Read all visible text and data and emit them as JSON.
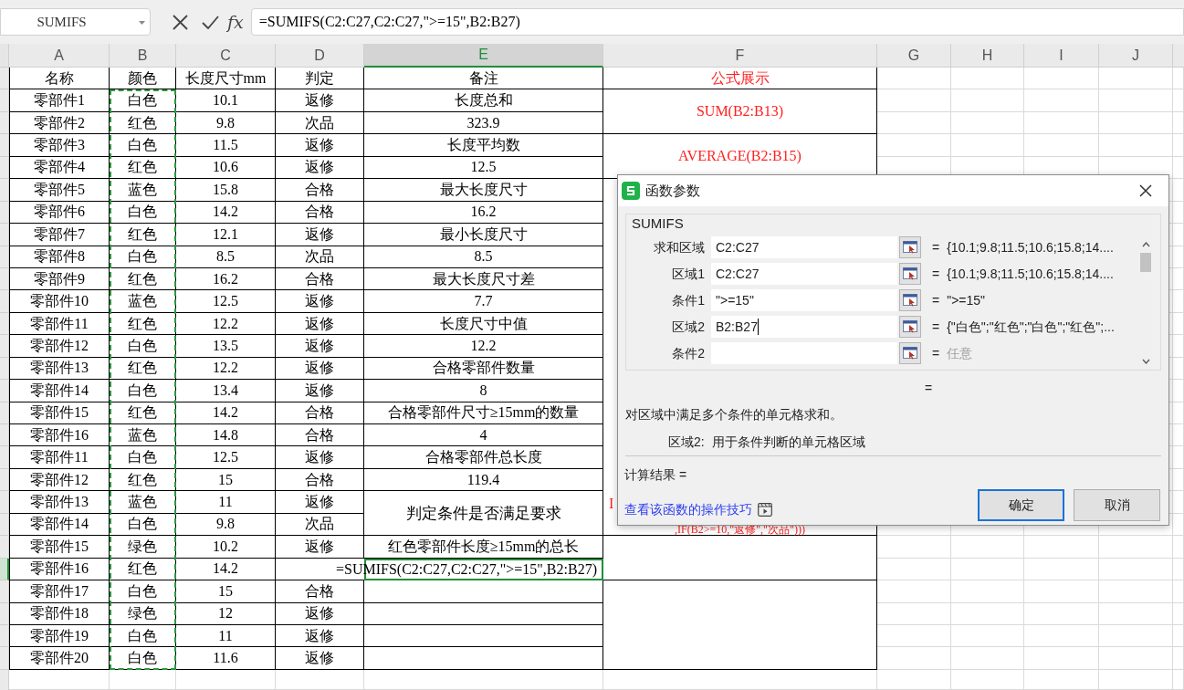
{
  "name_box": "SUMIFS",
  "fx_label": "fx",
  "formula_bar": {
    "value": "=SUMIFS(C2:C27,C2:C27,\">=15\",B2:B27)"
  },
  "columns": [
    {
      "label": "A",
      "selected": false
    },
    {
      "label": "B",
      "selected": false
    },
    {
      "label": "C",
      "selected": false
    },
    {
      "label": "D",
      "selected": false
    },
    {
      "label": "E",
      "selected": true
    },
    {
      "label": "F",
      "selected": false
    },
    {
      "label": "G",
      "selected": false
    },
    {
      "label": "H",
      "selected": false
    },
    {
      "label": "I",
      "selected": false
    },
    {
      "label": "J",
      "selected": false
    }
  ],
  "table": {
    "headers": [
      "名称",
      "颜色",
      "长度尺寸mm",
      "判定",
      "备注"
    ],
    "rows": [
      {
        "name": "零部件1",
        "shade": "白色",
        "length": "10.1",
        "verdict": "返修",
        "selected": false
      },
      {
        "name": "零部件2",
        "shade": "红色",
        "length": "9.8",
        "verdict": "次品",
        "selected": false
      },
      {
        "name": "零部件3",
        "shade": "白色",
        "length": "11.5",
        "verdict": "返修",
        "selected": false
      },
      {
        "name": "零部件4",
        "shade": "红色",
        "length": "10.6",
        "verdict": "返修",
        "selected": false
      },
      {
        "name": "零部件5",
        "shade": "蓝色",
        "length": "15.8",
        "verdict": "合格",
        "selected": false
      },
      {
        "name": "零部件6",
        "shade": "白色",
        "length": "14.2",
        "verdict": "合格",
        "selected": false
      },
      {
        "name": "零部件7",
        "shade": "红色",
        "length": "12.1",
        "verdict": "返修",
        "selected": false
      },
      {
        "name": "零部件8",
        "shade": "白色",
        "length": "8.5",
        "verdict": "次品",
        "selected": false
      },
      {
        "name": "零部件9",
        "shade": "红色",
        "length": "16.2",
        "verdict": "合格",
        "selected": false
      },
      {
        "name": "零部件10",
        "shade": "蓝色",
        "length": "12.5",
        "verdict": "返修",
        "selected": false
      },
      {
        "name": "零部件11",
        "shade": "红色",
        "length": "12.2",
        "verdict": "返修",
        "selected": false
      },
      {
        "name": "零部件12",
        "shade": "白色",
        "length": "13.5",
        "verdict": "返修",
        "selected": false
      },
      {
        "name": "零部件13",
        "shade": "红色",
        "length": "12.2",
        "verdict": "返修",
        "selected": false
      },
      {
        "name": "零部件14",
        "shade": "白色",
        "length": "13.4",
        "verdict": "返修",
        "selected": false
      },
      {
        "name": "零部件15",
        "shade": "红色",
        "length": "14.2",
        "verdict": "合格",
        "selected": false
      },
      {
        "name": "零部件16",
        "shade": "蓝色",
        "length": "14.8",
        "verdict": "合格",
        "selected": false
      },
      {
        "name": "零部件11",
        "shade": "白色",
        "length": "12.5",
        "verdict": "返修",
        "selected": false
      },
      {
        "name": "零部件12",
        "shade": "红色",
        "length": "15",
        "verdict": "合格",
        "selected": false
      },
      {
        "name": "零部件13",
        "shade": "蓝色",
        "length": "11",
        "verdict": "返修",
        "selected": false
      },
      {
        "name": "零部件14",
        "shade": "白色",
        "length": "9.8",
        "verdict": "次品",
        "selected": false
      },
      {
        "name": "零部件15",
        "shade": "绿色",
        "length": "10.2",
        "verdict": "返修",
        "selected": false
      },
      {
        "name": "零部件16",
        "shade": "红色",
        "length": "14.2",
        "selected": true
      },
      {
        "name": "零部件17",
        "shade": "白色",
        "length": "15",
        "verdict": "合格",
        "selected": false
      },
      {
        "name": "零部件18",
        "shade": "绿色",
        "length": "12",
        "verdict": "返修",
        "selected": false
      },
      {
        "name": "零部件19",
        "shade": "白色",
        "length": "11",
        "verdict": "返修",
        "selected": false
      },
      {
        "name": "零部件20",
        "shade": "白色",
        "length": "11.6",
        "verdict": "返修",
        "selected": false
      }
    ]
  },
  "notes": [
    {
      "kind": "single",
      "text": "长度总和"
    },
    {
      "kind": "single",
      "text": "323.9"
    },
    {
      "kind": "single",
      "text": "长度平均数"
    },
    {
      "kind": "single",
      "text": "12.5"
    },
    {
      "kind": "single",
      "text": "最大长度尺寸"
    },
    {
      "kind": "single",
      "text": "16.2"
    },
    {
      "kind": "single",
      "text": "最小长度尺寸"
    },
    {
      "kind": "single",
      "text": "8.5"
    },
    {
      "kind": "single",
      "text": "最大长度尺寸差"
    },
    {
      "kind": "single",
      "text": "7.7"
    },
    {
      "kind": "single",
      "text": "长度尺寸中值"
    },
    {
      "kind": "single",
      "text": "12.2"
    },
    {
      "kind": "single",
      "text": "合格零部件数量"
    },
    {
      "kind": "single",
      "text": "8"
    },
    {
      "kind": "single",
      "text": "合格零部件尺寸≥15mm的数量"
    },
    {
      "kind": "single",
      "text": "4"
    },
    {
      "kind": "single",
      "text": "合格零部件总长度"
    },
    {
      "kind": "single",
      "text": "119.4"
    },
    {
      "kind": "double",
      "text": "判定条件是否满足要求"
    },
    {
      "kind": "single",
      "text": "红色零部件长度≥15mm的总长"
    },
    {
      "kind": "editing",
      "text": "=SUMIFS(C2:C27,C2:C27,\">=15\",B2:B27)"
    }
  ],
  "formulas": [
    {
      "kind": "header",
      "text": "公式展示"
    },
    {
      "kind": "pair",
      "text": "SUM(B2:B13)"
    },
    {
      "kind": "pair",
      "text": "AVERAGE(B2:B15)"
    },
    {
      "kind": "wrapped",
      "lines": [
        "I",
        ",IF(B2>=10,\"返修\",\"次品\")))"
      ]
    }
  ],
  "dialog": {
    "title": "函数参数",
    "function": "SUMIFS",
    "args": [
      {
        "label": "求和区域",
        "value": "C2:C27",
        "sign": "=",
        "result": "{10.1;9.8;11.5;10.6;15.8;14....",
        "kind": "filled",
        "focused": false
      },
      {
        "label": "区域1",
        "value": "C2:C27",
        "sign": "=",
        "result": "{10.1;9.8;11.5;10.6;15.8;14....",
        "kind": "filled",
        "focused": false
      },
      {
        "label": "条件1",
        "value": "\">=15\"",
        "sign": "=",
        "result": "\">=15\"",
        "kind": "filled",
        "focused": false
      },
      {
        "label": "区域2",
        "value": "B2:B27",
        "sign": "=",
        "result": "{\"白色\";\"红色\";\"白色\";\"红色\";...",
        "kind": "filled",
        "focused": true
      },
      {
        "label": "条件2",
        "sign": "=",
        "result": "任意",
        "kind": "empty",
        "focused": false
      }
    ],
    "preview": "=",
    "description": "对区域中满足多个条件的单元格求和。",
    "arg_help": {
      "label": "区域2:",
      "text": "用于条件判断的单元格区域"
    },
    "calc_result": "计算结果 =",
    "help_link": "查看该函数的操作技巧",
    "buttons": [
      {
        "label": "确定",
        "focused": true
      },
      {
        "label": "取消",
        "focused": false
      }
    ]
  }
}
